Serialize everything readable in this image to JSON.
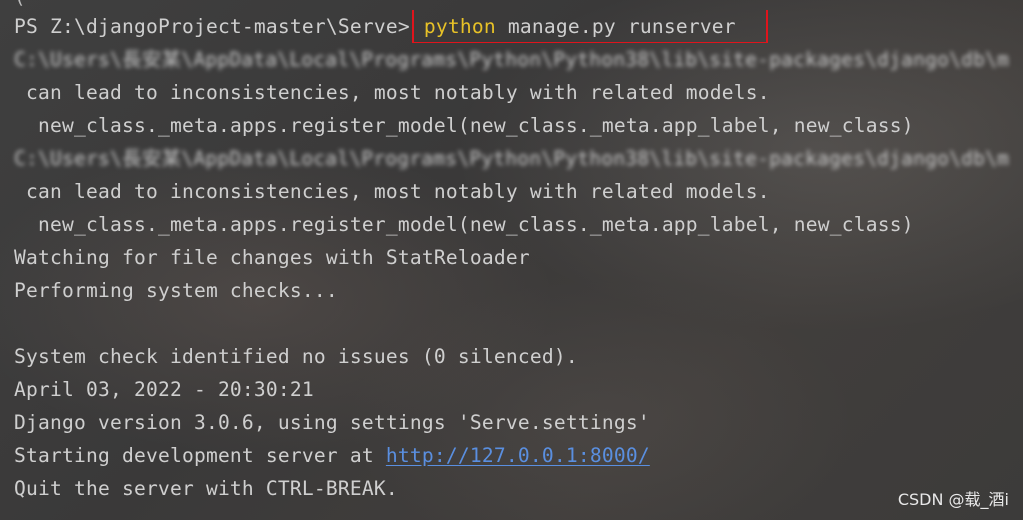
{
  "terminal": {
    "prompt": "PS Z:\\djangoProject-master\\Serve>",
    "command_program": "python",
    "command_args": " manage.py runserver",
    "blurred_path_1": "C:\\Users\\長安某\\AppData\\Local\\Programs\\Python\\Python38\\lib\\site-packages\\django\\db\\m",
    "warning_1a": "can lead to inconsistencies, most notably with related models.",
    "warning_1b": "new_class._meta.apps.register_model(new_class._meta.app_label, new_class)",
    "blurred_path_2": "C:\\Users\\長安某\\AppData\\Local\\Programs\\Python\\Python38\\lib\\site-packages\\django\\db\\m",
    "warning_2a": "can lead to inconsistencies, most notably with related models.",
    "warning_2b": "new_class._meta.apps.register_model(new_class._meta.app_label, new_class)",
    "watching": "Watching for file changes with StatReloader",
    "performing": "Performing system checks...",
    "blank": "",
    "check_result": "System check identified no issues (0 silenced).",
    "datetime": "April 03, 2022 - 20:30:21",
    "django_version": "Django version 3.0.6, using settings 'Serve.settings'",
    "starting_prefix": "Starting development server at ",
    "server_url": "http://127.0.0.1:8000/",
    "quit_hint": "Quit the server with CTRL-BREAK."
  },
  "watermark": "CSDN @载_酒i",
  "colors": {
    "command_program": "#e8c227",
    "highlight_box": "#e0141c",
    "link": "#5a8fe0",
    "text": "#cfcfcf"
  }
}
